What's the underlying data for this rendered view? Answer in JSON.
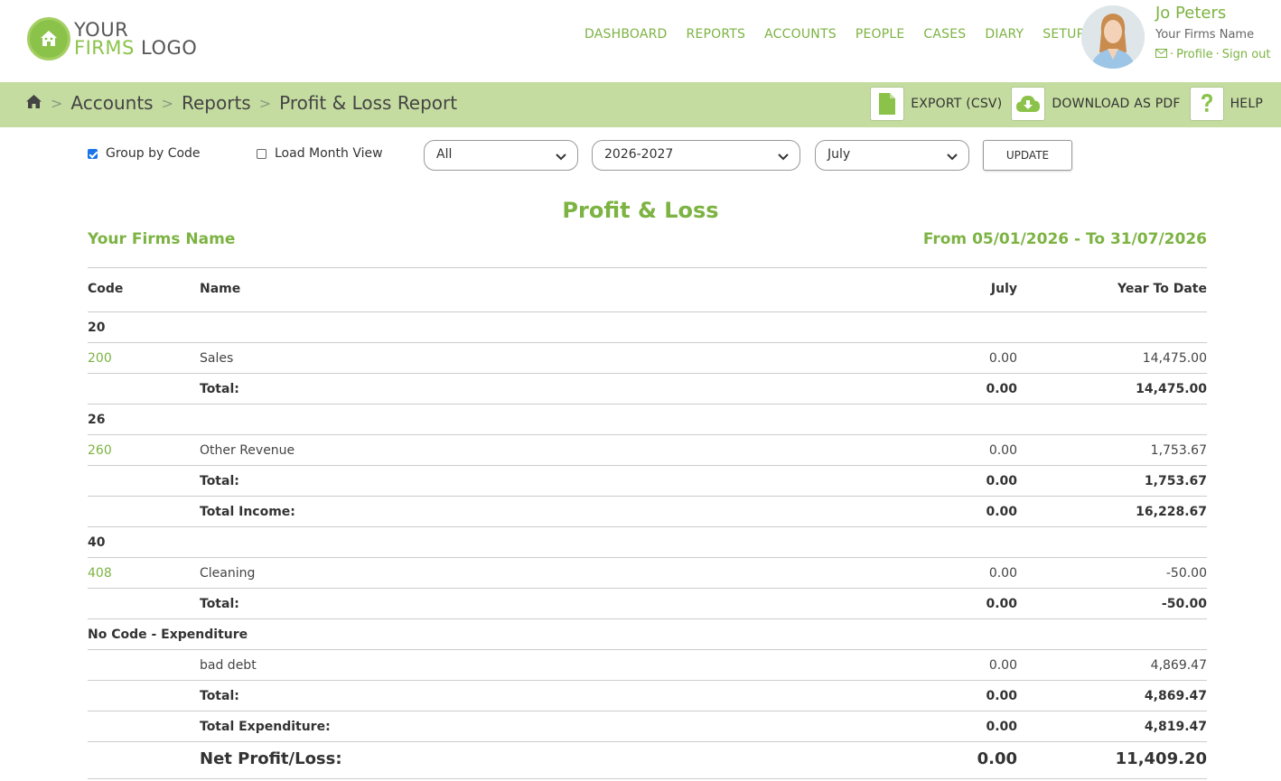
{
  "logo": {
    "line1": "YOUR",
    "line2a": "FIRMS",
    "line2b": "LOGO"
  },
  "nav": [
    "DASHBOARD",
    "REPORTS",
    "ACCOUNTS",
    "PEOPLE",
    "CASES",
    "DIARY",
    "SETUP"
  ],
  "user": {
    "name": "Jo Peters",
    "firm": "Your Firms Name",
    "profile": "Profile",
    "signout": "Sign out",
    "sep": "·"
  },
  "breadcrumb": {
    "items": [
      "Accounts",
      "Reports",
      "Profit & Loss Report"
    ],
    "sep": ">"
  },
  "actions": {
    "export": "EXPORT (CSV)",
    "pdf": "DOWNLOAD AS PDF",
    "help": "HELP"
  },
  "filters": {
    "group_by_code": "Group by Code",
    "load_month_view": "Load Month View",
    "filter_select": "All",
    "year_select": "2026-2027",
    "month_select": "July",
    "update": "UPDATE"
  },
  "report": {
    "title": "Profit & Loss",
    "firm": "Your Firms Name",
    "range": "From 05/01/2026 - To 31/07/2026",
    "headers": {
      "code": "Code",
      "name": "Name",
      "july": "July",
      "ytd": "Year To Date"
    },
    "rows": [
      {
        "code": "20",
        "name": "",
        "july": "",
        "ytd": ""
      },
      {
        "code": "200",
        "name": "Sales",
        "july": "0.00",
        "ytd": "14,475.00"
      },
      {
        "code": "",
        "name": "Total:",
        "july": "0.00",
        "ytd": "14,475.00"
      },
      {
        "code": "26",
        "name": "",
        "july": "",
        "ytd": ""
      },
      {
        "code": "260",
        "name": "Other Revenue",
        "july": "0.00",
        "ytd": "1,753.67"
      },
      {
        "code": "",
        "name": "Total:",
        "july": "0.00",
        "ytd": "1,753.67"
      },
      {
        "code": "",
        "name": "Total Income:",
        "july": "0.00",
        "ytd": "16,228.67"
      },
      {
        "code": "40",
        "name": "",
        "july": "",
        "ytd": ""
      },
      {
        "code": "408",
        "name": "Cleaning",
        "july": "0.00",
        "ytd": "-50.00"
      },
      {
        "code": "",
        "name": "Total:",
        "july": "0.00",
        "ytd": "-50.00"
      },
      {
        "code": "No Code - Expenditure",
        "name": "",
        "july": "",
        "ytd": ""
      },
      {
        "code": "",
        "name": "bad debt",
        "july": "0.00",
        "ytd": "4,869.47"
      },
      {
        "code": "",
        "name": "Total:",
        "july": "0.00",
        "ytd": "4,869.47"
      },
      {
        "code": "",
        "name": "Total Expenditure:",
        "july": "0.00",
        "ytd": "4,819.47"
      }
    ],
    "net": {
      "name": "Net Profit/Loss:",
      "july": "0.00",
      "ytd": "11,409.20"
    }
  }
}
